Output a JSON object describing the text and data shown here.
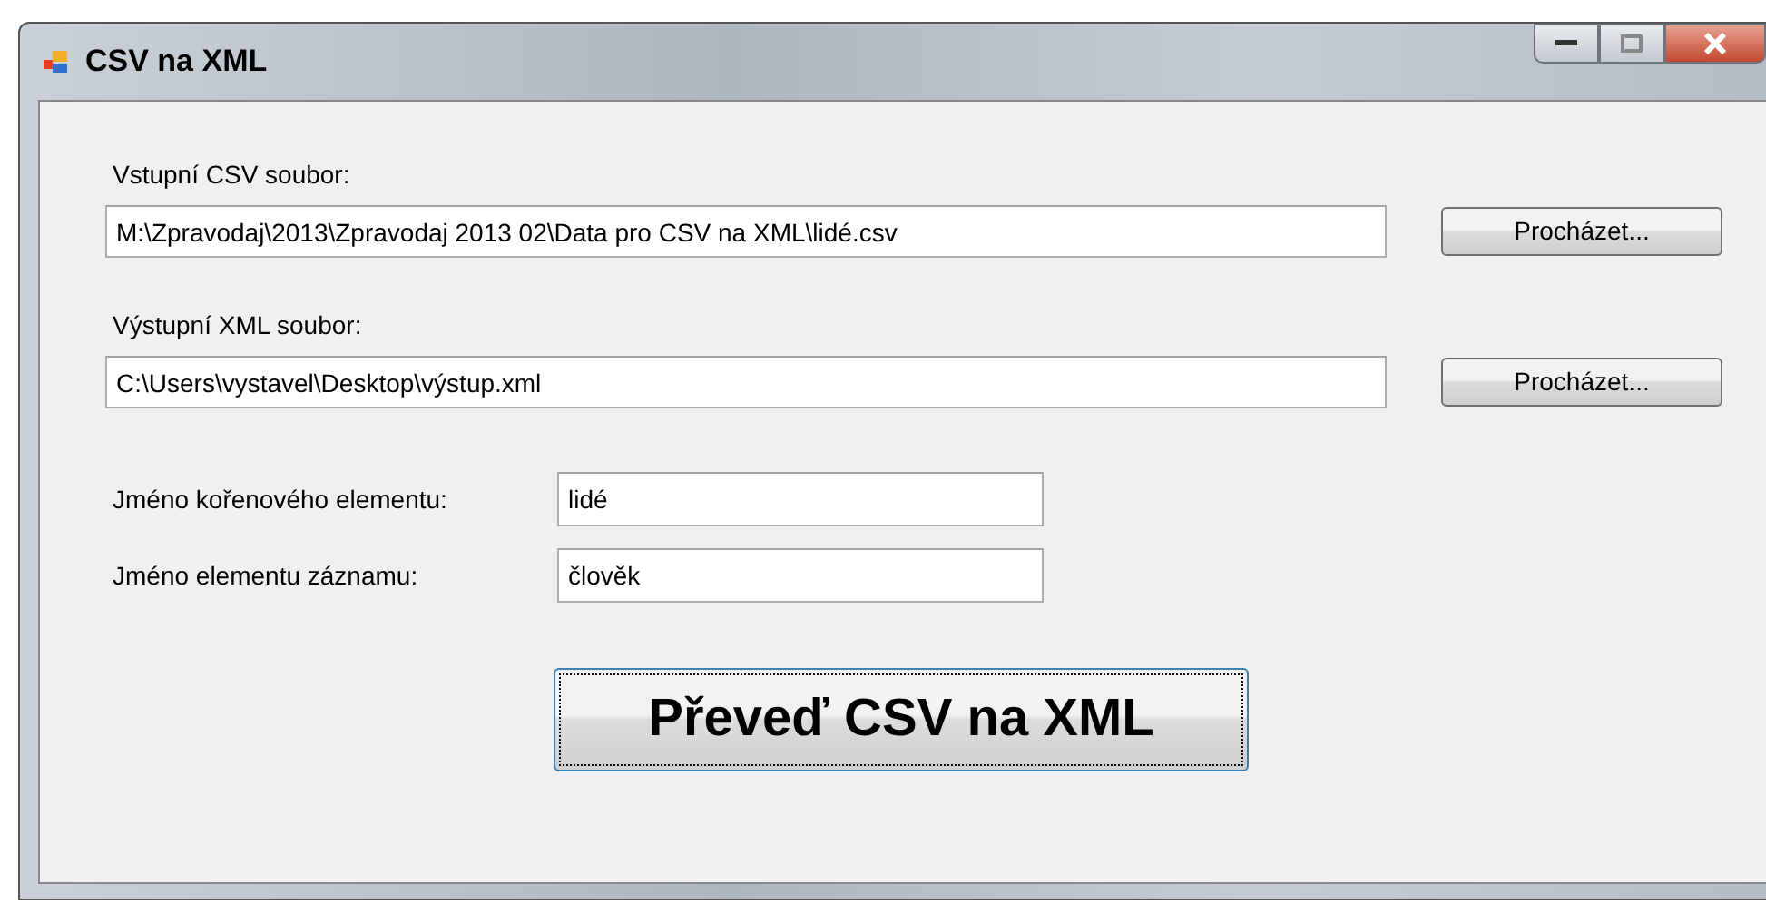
{
  "window": {
    "title": "CSV na XML"
  },
  "file_fields": [
    {
      "label": "Vstupní CSV soubor:",
      "value": "M:\\Zpravodaj\\2013\\Zpravodaj 2013 02\\Data pro CSV na XML\\lidé.csv",
      "button": "Procházet..."
    },
    {
      "label": "Výstupní XML soubor:",
      "value": "C:\\Users\\vystavel\\Desktop\\výstup.xml",
      "button": "Procházet..."
    }
  ],
  "name_fields": [
    {
      "label": "Jméno kořenového elementu:",
      "value": "lidé"
    },
    {
      "label": "Jméno elementu záznamu:",
      "value": "člověk"
    }
  ],
  "convert_button": {
    "label": "Převeď CSV na XML",
    "focused": true
  }
}
